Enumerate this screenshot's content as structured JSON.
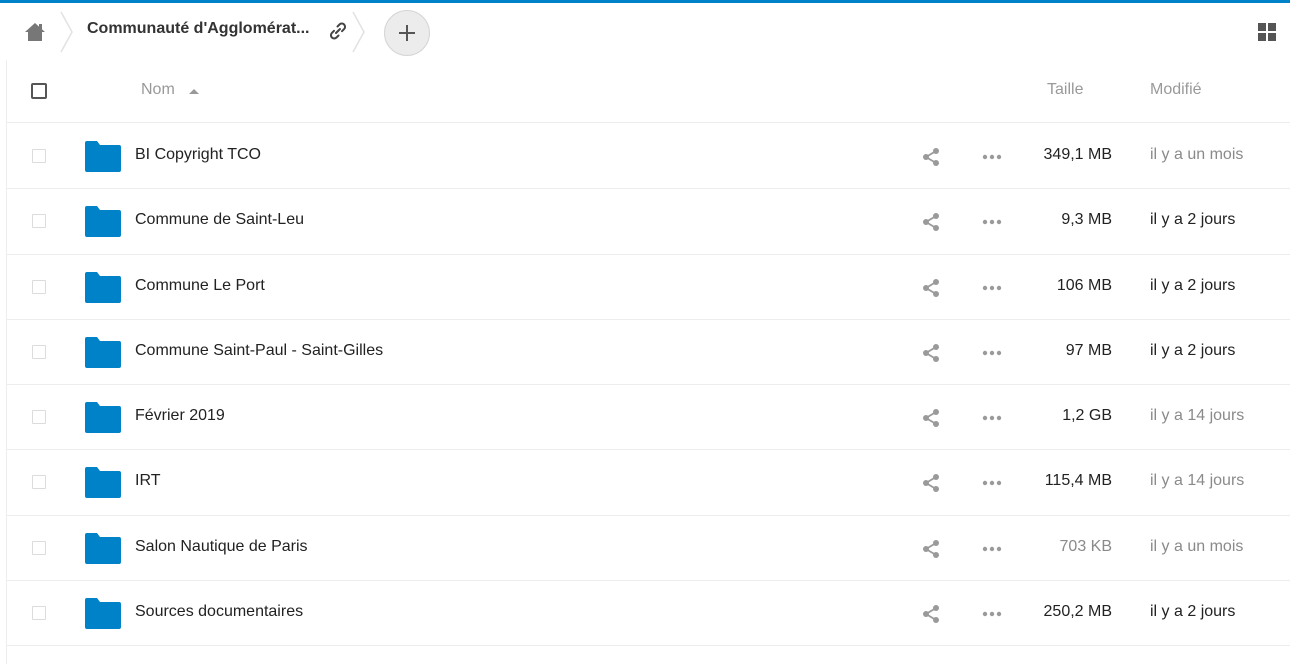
{
  "breadcrumb": {
    "home_icon": "home-icon",
    "current_folder": "Communauté d'Agglomérat...",
    "link_icon": "link-icon",
    "add_icon": "plus-icon"
  },
  "view_toggle_icon": "grid-view-icon",
  "accent_color": "#0082c9",
  "table": {
    "columns": {
      "name": "Nom",
      "size": "Taille",
      "modified": "Modifié"
    },
    "rows": [
      {
        "name": "BI Copyright TCO",
        "size": "349,1 MB",
        "modified": "il y a un mois",
        "muted_size": false,
        "muted_date": true
      },
      {
        "name": "Commune de Saint-Leu",
        "size": "9,3 MB",
        "modified": "il y a 2 jours",
        "muted_size": false,
        "muted_date": false
      },
      {
        "name": "Commune Le Port",
        "size": "106 MB",
        "modified": "il y a 2 jours",
        "muted_size": false,
        "muted_date": false
      },
      {
        "name": "Commune Saint-Paul - Saint-Gilles",
        "size": "97 MB",
        "modified": "il y a 2 jours",
        "muted_size": false,
        "muted_date": false
      },
      {
        "name": "Février 2019",
        "size": "1,2 GB",
        "modified": "il y a 14 jours",
        "muted_size": false,
        "muted_date": true
      },
      {
        "name": "IRT",
        "size": "115,4 MB",
        "modified": "il y a 14 jours",
        "muted_size": false,
        "muted_date": true
      },
      {
        "name": "Salon Nautique de Paris",
        "size": "703 KB",
        "modified": "il y a un mois",
        "muted_size": true,
        "muted_date": true
      },
      {
        "name": "Sources documentaires",
        "size": "250,2 MB",
        "modified": "il y a 2 jours",
        "muted_size": false,
        "muted_date": false
      }
    ]
  }
}
